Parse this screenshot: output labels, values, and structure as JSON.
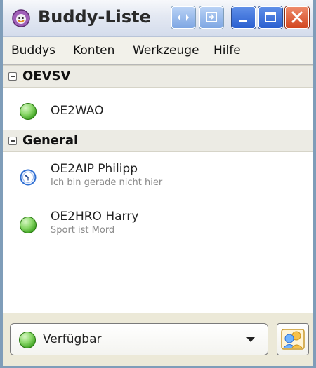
{
  "window": {
    "title": "Buddy-Liste",
    "controls": {
      "left_arrow_icon": "double-arrow-icon",
      "dock_icon": "dock-icon",
      "minimize_icon": "minimize-icon",
      "maximize_icon": "maximize-icon",
      "close_icon": "close-icon"
    }
  },
  "menu": [
    {
      "label": "Buddys",
      "mnemonic_index": 0
    },
    {
      "label": "Konten",
      "mnemonic_index": 0
    },
    {
      "label": "Werkzeuge",
      "mnemonic_index": 0
    },
    {
      "label": "Hilfe",
      "mnemonic_index": 0
    }
  ],
  "groups": [
    {
      "name": "OEVSV",
      "buddies": [
        {
          "name": "OE2WAO",
          "status_text": "",
          "status_icon": "available-icon"
        }
      ]
    },
    {
      "name": "General",
      "buddies": [
        {
          "name": "OE2AIP Philipp",
          "status_text": "Ich bin gerade nicht hier",
          "status_icon": "away-clock-icon"
        },
        {
          "name": "OE2HRO Harry",
          "status_text": "Sport ist Mord",
          "status_icon": "available-icon"
        }
      ]
    }
  ],
  "status_selector": {
    "label": "Verfügbar",
    "icon": "available-icon",
    "dropdown_icon": "chevron-down-icon"
  },
  "avatar_button": {
    "icon": "buddy-avatar-icon"
  },
  "colors": {
    "available": "#3ca11f",
    "away": "#2f6fd3",
    "close_button": "#d2451f",
    "titlebar_buttons": "#7ea6e3"
  }
}
